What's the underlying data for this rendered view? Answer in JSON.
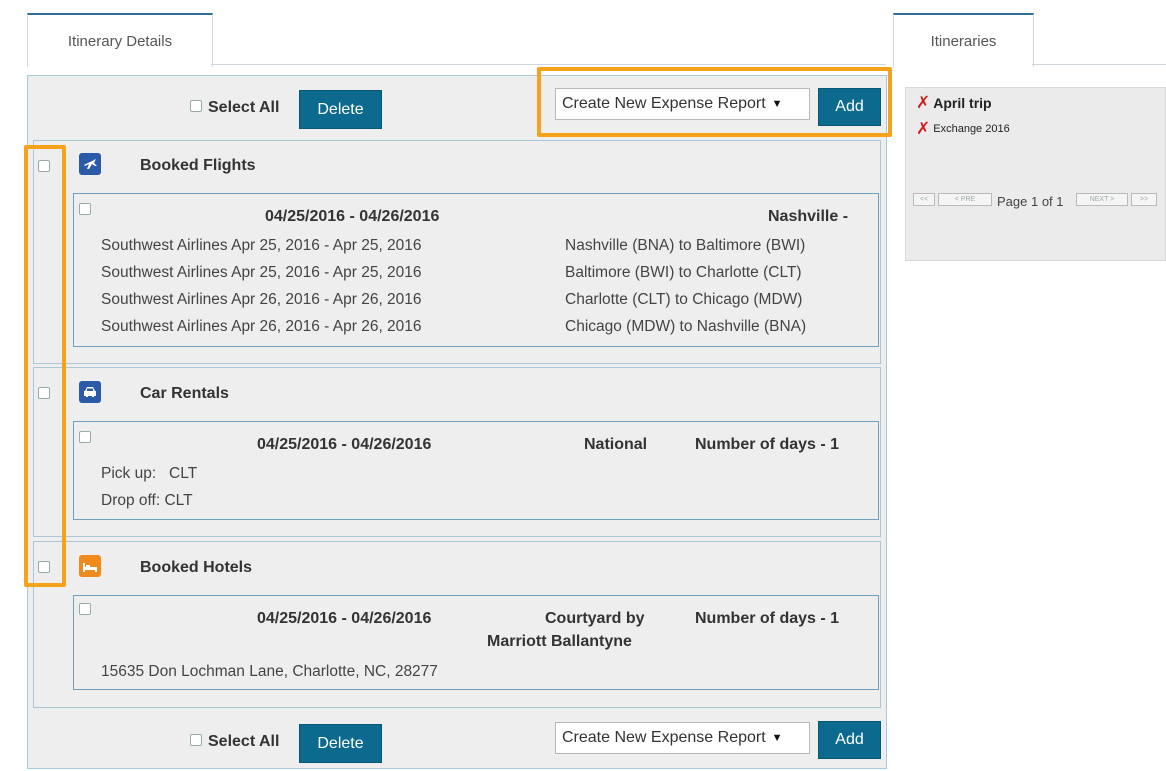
{
  "tabs": {
    "itinerary_details": "Itinerary Details",
    "itineraries": "Itineraries"
  },
  "toolbar": {
    "select_all": "Select All",
    "delete": "Delete",
    "expense_report_selected": "Create New Expense Report",
    "add": "Add"
  },
  "flights": {
    "title": "Booked Flights",
    "date_range": "04/25/2016 - 04/26/2016",
    "destination": "Nashville -",
    "legs": [
      {
        "airline": "Southwest Airlines Apr 25, 2016 - Apr 25, 2016",
        "route": "Nashville (BNA) to Baltimore (BWI)"
      },
      {
        "airline": "Southwest Airlines Apr 25, 2016 - Apr 25, 2016",
        "route": "Baltimore (BWI) to Charlotte (CLT)"
      },
      {
        "airline": "Southwest Airlines Apr 26, 2016 - Apr 26, 2016",
        "route": "Charlotte (CLT) to Chicago (MDW)"
      },
      {
        "airline": "Southwest Airlines Apr 26, 2016 - Apr 26, 2016",
        "route": "Chicago (MDW) to Nashville (BNA)"
      }
    ]
  },
  "car": {
    "title": "Car Rentals",
    "date_range": "04/25/2016 - 04/26/2016",
    "company": "National",
    "days": "Number of days - 1",
    "pickup": "Pick up:   CLT",
    "dropoff": "Drop off: CLT"
  },
  "hotel": {
    "title": "Booked Hotels",
    "date_range": "04/25/2016 - 04/26/2016",
    "name_line1": "Courtyard by",
    "name_line2": "Marriott Ballantyne",
    "days": "Number of days - 1",
    "address": "15635 Don Lochman Lane, Charlotte, NC, 28277"
  },
  "itineraries": {
    "items": [
      "April trip",
      "Exchange 2016"
    ],
    "pager": {
      "first": "<<",
      "prev": "< PRE",
      "page_text": "Page 1 of 1",
      "next": "NEXT >",
      "last": ">>"
    }
  },
  "colors": {
    "accent": "#0b6a8e",
    "highlight": "#f7a21b",
    "delete_x": "#d12020"
  }
}
